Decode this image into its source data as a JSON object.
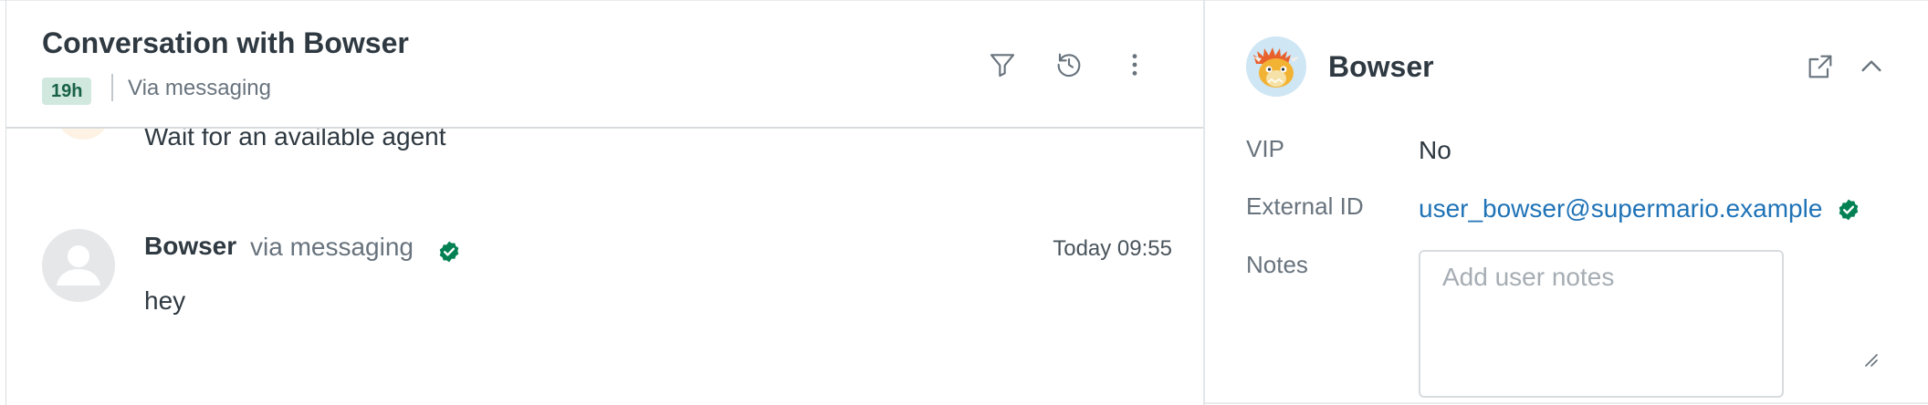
{
  "conversation": {
    "title": "Conversation with Bowser",
    "sla_badge": "19h",
    "channel": "Via messaging",
    "header_icons": [
      "filter-icon",
      "history-icon",
      "more-vertical-icon"
    ],
    "messages": [
      {
        "body": "Wait for an available agent"
      },
      {
        "author": "Bowser",
        "channel": "via messaging",
        "verified": true,
        "time": "Today 09:55",
        "body": "hey"
      }
    ]
  },
  "user_panel": {
    "name": "Bowser",
    "header_icons": [
      "open-external-icon",
      "chevron-up-icon"
    ],
    "fields": {
      "vip_label": "VIP",
      "vip_value": "No",
      "external_id_label": "External ID",
      "external_id_value": "user_bowser@supermario.example",
      "notes_label": "Notes",
      "notes_placeholder": "Add user notes",
      "notes_value": ""
    }
  },
  "colors": {
    "verified": "#038153",
    "sla_badge_bg": "#d1e8df",
    "sla_badge_text": "#186146",
    "link": "#1f73b7"
  }
}
